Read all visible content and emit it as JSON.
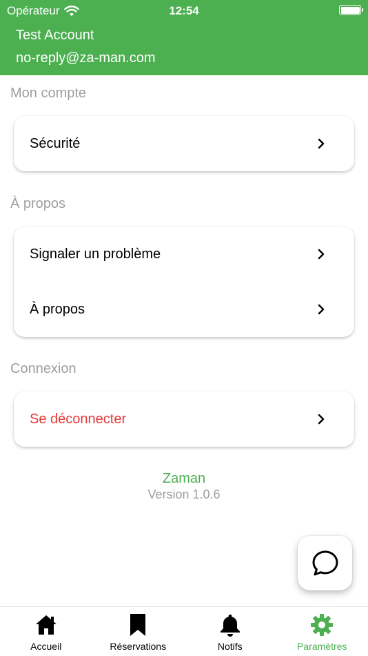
{
  "status_bar": {
    "carrier": "Opérateur",
    "time": "12:54"
  },
  "account": {
    "name": "Test Account",
    "email": "no-reply@za-man.com"
  },
  "sections": {
    "my_account": {
      "title": "Mon compte",
      "items": [
        {
          "label": "Sécurité"
        }
      ]
    },
    "about": {
      "title": "À propos",
      "items": [
        {
          "label": "Signaler un problème"
        },
        {
          "label": "À propos"
        }
      ]
    },
    "connection": {
      "title": "Connexion",
      "items": [
        {
          "label": "Se déconnecter"
        }
      ]
    }
  },
  "app_info": {
    "name": "Zaman",
    "version": "Version 1.0.6"
  },
  "tabs": [
    {
      "label": "Accueil",
      "icon": "home-icon"
    },
    {
      "label": "Réservations",
      "icon": "bookmark-icon"
    },
    {
      "label": "Notifs",
      "icon": "bell-icon"
    },
    {
      "label": "Paramètres",
      "icon": "gear-icon",
      "active": true
    }
  ],
  "colors": {
    "primary": "#4caf50",
    "danger": "#e53935",
    "muted": "#9e9e9e"
  }
}
